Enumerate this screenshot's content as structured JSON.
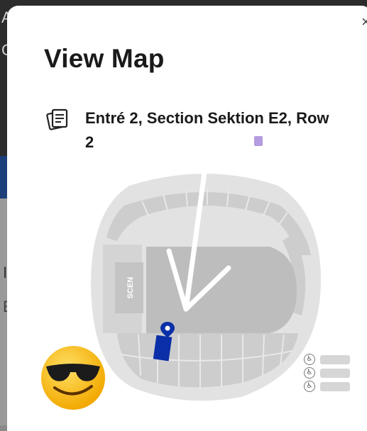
{
  "background": {
    "letters": [
      "A",
      "C",
      "I",
      "E"
    ]
  },
  "modal": {
    "title": "View Map",
    "close_icon": "×",
    "location": "Entré 2, Section Sektion E2, Row 2",
    "ticket_icon": "ticket-icon"
  },
  "map": {
    "stage_label": "SCEN",
    "colors": {
      "venue": "#dcdcdc",
      "sections": "#c9c9c9",
      "floor": "#bdbdbd",
      "selected_section": "#0b2fa8",
      "pin": "#0b2fa8"
    }
  },
  "legend": {
    "items": [
      {
        "icon": "wheelchair-icon",
        "glyph": "♿"
      },
      {
        "icon": "wheelchair-icon",
        "glyph": "♿"
      },
      {
        "icon": "wheelchair-icon",
        "glyph": "♿"
      }
    ]
  },
  "overlay": {
    "emoji": "sunglasses-emoji"
  }
}
